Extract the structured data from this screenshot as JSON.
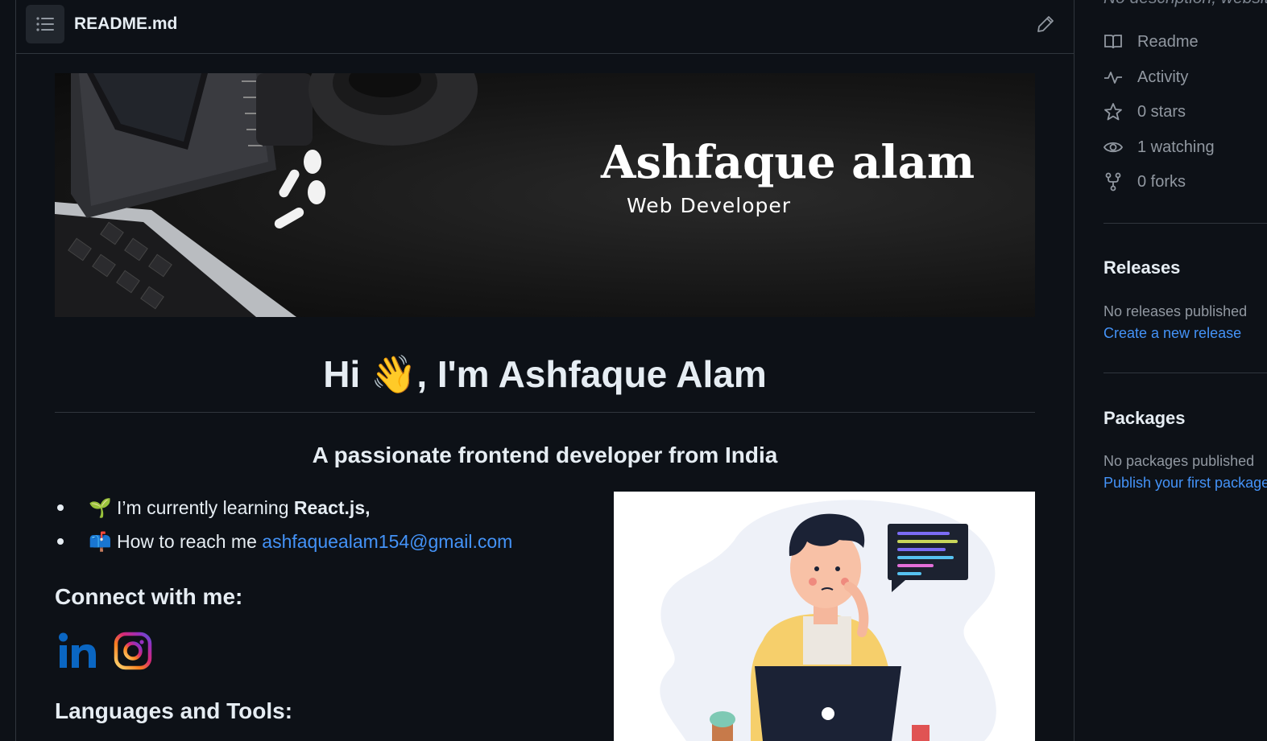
{
  "file": {
    "name": "README.md"
  },
  "banner": {
    "name": "Ashfaque alam",
    "role": "Web Developer"
  },
  "readme": {
    "greeting": "Hi 👋, I'm Ashfaque Alam",
    "subtitle": "A passionate frontend developer from India",
    "learning_emoji": "🌱",
    "learning_prefix": "I’m currently learning ",
    "learning_topic": "React.js,",
    "reach_emoji": "📫",
    "reach_prefix": "How to reach me ",
    "email": "ashfaquealam154@gmail.com",
    "connect_heading": "Connect with me:",
    "languages_heading": "Languages and Tools:",
    "social_icons": [
      "linkedin-icon",
      "instagram-icon"
    ]
  },
  "sidebar": {
    "description": "No description, website",
    "meta": [
      {
        "icon": "book-icon",
        "label": "Readme"
      },
      {
        "icon": "pulse-icon",
        "label": "Activity"
      },
      {
        "icon": "star-icon",
        "label": "0 stars"
      },
      {
        "icon": "eye-icon",
        "label": "1 watching"
      },
      {
        "icon": "fork-icon",
        "label": "0 forks"
      }
    ],
    "releases": {
      "heading": "Releases",
      "status": "No releases published",
      "link": "Create a new release"
    },
    "packages": {
      "heading": "Packages",
      "status": "No packages published",
      "link": "Publish your first package"
    }
  },
  "colors": {
    "background": "#0d1117",
    "border": "#30363d",
    "link": "#4493f8",
    "text": "#e6edf3",
    "muted": "#9198a1"
  }
}
